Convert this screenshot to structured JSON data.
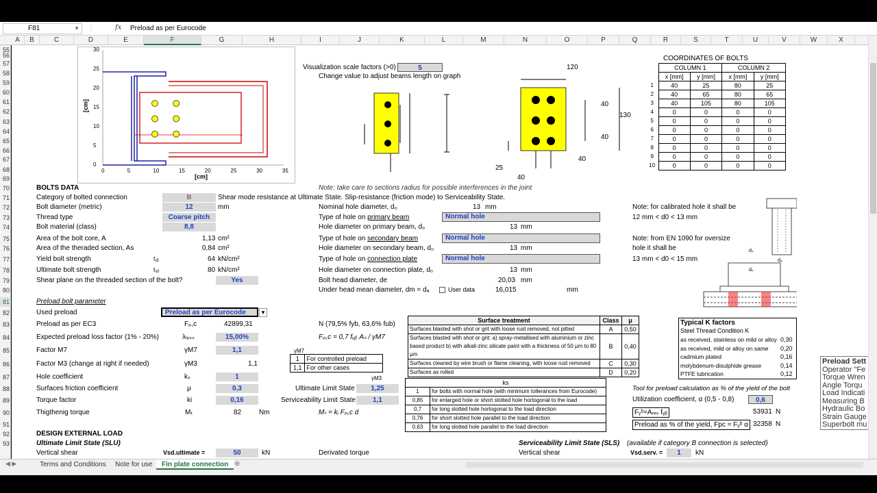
{
  "namebox": "F81",
  "formula": "Preload as per Eurocode",
  "columns": [
    "A",
    "B",
    "C",
    "D",
    "E",
    "F",
    "G",
    "H",
    "I",
    "J",
    "K",
    "L",
    "M",
    "N",
    "O",
    "P",
    "Q",
    "R",
    "S",
    "T",
    "U",
    "V",
    "W",
    "X"
  ],
  "rows": [
    "55",
    "56",
    "57",
    "58",
    "59",
    "60",
    "61",
    "62",
    "63",
    "64",
    "65",
    "66",
    "67",
    "68",
    "69",
    "70",
    "71",
    "72",
    "73",
    "74",
    "75",
    "76",
    "77",
    "78",
    "79",
    "80",
    "81",
    "82",
    "83",
    "84",
    "85",
    "86",
    "87",
    "88",
    "89",
    "90",
    "91",
    "92",
    "93"
  ],
  "selected_row": "81",
  "selected_column": "F",
  "chart": {
    "ylabel": "[cm]",
    "xlabel": "[cm]",
    "yticks": [
      "30",
      "25",
      "20",
      "15",
      "10",
      "5",
      "0"
    ],
    "xticks": [
      "0",
      "5",
      "10",
      "15",
      "20",
      "25",
      "30",
      "35"
    ]
  },
  "viz": {
    "label": "Visualization scale factors (>0)",
    "value": "5",
    "note": "Change value to adjust beams length on graph"
  },
  "diagram": {
    "d120": "120",
    "d40a": "40",
    "d130": "130",
    "d40b": "40",
    "d25": "25",
    "d40c": "40",
    "d40d": "40"
  },
  "coords": {
    "title": "COORDINATES OF BOLTS",
    "col1": "COLUMN 1",
    "col2": "COLUMN 2",
    "sub": [
      "x [mm]",
      "y [mm]",
      "x [mm]",
      "y [mm]"
    ],
    "rows": [
      [
        "1",
        "40",
        "25",
        "80",
        "25"
      ],
      [
        "2",
        "40",
        "65",
        "80",
        "65"
      ],
      [
        "3",
        "40",
        "105",
        "80",
        "105"
      ],
      [
        "4",
        "0",
        "0",
        "0",
        "0"
      ],
      [
        "5",
        "0",
        "0",
        "0",
        "0"
      ],
      [
        "6",
        "0",
        "0",
        "0",
        "0"
      ],
      [
        "7",
        "0",
        "0",
        "0",
        "0"
      ],
      [
        "8",
        "0",
        "0",
        "0",
        "0"
      ],
      [
        "9",
        "0",
        "0",
        "0",
        "0"
      ],
      [
        "10",
        "0",
        "0",
        "0",
        "0"
      ]
    ]
  },
  "bolts": {
    "title": "BOLTS DATA",
    "category_label": "Category of bolted connection",
    "category_value": "B",
    "category_desc": "Shear mode resistance at Ultimate State. Slip-resistance (friction mode) to Serviceability State.",
    "diameter_label": "Bolt diameter (metric)",
    "diameter_value": "12",
    "diameter_unit": "mm",
    "thread_label": "Thread type",
    "thread_value": "Coarse pitch",
    "material_label": "Bolt material (class)",
    "material_value": "8,8",
    "area_core_label": "Area of the bolt core, A",
    "area_core_value": "1,13",
    "area_unit": "cm²",
    "area_thread_label": "Area of the theraded section, As",
    "area_thread_value": "0,84",
    "yield_label": "Yield bolt strength",
    "yield_sym": "fᵧᵦ",
    "yield_value": "64",
    "strength_unit": "kN/cm²",
    "ult_label": "Ultimate bolt strength",
    "ult_sym": "fᵤᵦ",
    "ult_value": "80",
    "shear_label": "Shear plane on the threaded section of the bolt?",
    "shear_value": "Yes",
    "note_sections": "Note: take care to sections radius for possible interferences in the joint"
  },
  "holes": {
    "nominal_label": "Nominal hole diameter, d₀",
    "nominal_value": "13",
    "unit": "mm",
    "type_primary_label": "Type of hole on ",
    "type_primary_link": "primary beam",
    "type_primary_value": "Normal hole",
    "dia_primary_label": "Hole diameter on primary beam, d₀",
    "dia_primary_value": "13",
    "type_secondary_label": "Type of hole on ",
    "type_secondary_link": "secondary beam",
    "type_secondary_value": "Normal hole",
    "dia_secondary_label": "Hole diameter on secondary beam, d₀",
    "dia_secondary_value": "13",
    "type_plate_label": "Type of hole on ",
    "type_plate_link": "connection plate",
    "type_plate_value": "Normal hole",
    "dia_plate_label": "Hole diameter on connection plate, d₀",
    "dia_plate_value": "13",
    "head_label": "Bolt head diameter, de",
    "head_value": "20,03",
    "under_label": "Under head mean diameter, dm = dₐ",
    "user_data": "User data",
    "under_value": "16,015"
  },
  "notes": {
    "cal1": "Note: for calibrated hole it shall be",
    "cal2": "12 mm < d0 < 13 mm",
    "en1": "Note:  from EN 1090 for oversize",
    "en2": "hole it shall be",
    "en3": "13 mm < d0 < 15 mm"
  },
  "preload": {
    "title": "Preload bolt parameter",
    "used_label": "Used preload",
    "used_value": "Preload as per Eurocode",
    "ec3_label": "Preload as per EC3",
    "ec3_sym": "Fₚ,c",
    "ec3_value": "42899,31",
    "ec3_unit": "N  (79,5% fyb, 63,6% fub)",
    "loss_label": "Expected preload loss factor (1% - 20%)",
    "loss_sym": "λₗₒₛₛ",
    "loss_value": "15,00%",
    "fpc_formula": "Fₚ,c = 0,7 fᵤᵦ Aₛ / γM7",
    "m7_label": "Factor M7",
    "m7_sym": "γM7",
    "m7_value": "1,1",
    "m3_label": "Factor M3 (change at right if needed)",
    "m3_sym": "γM3",
    "m3_value": "1,1",
    "gm7_head": "γM7",
    "gm7_rows": [
      [
        "1",
        "For controlled preload"
      ],
      [
        "1,1",
        "For other cases"
      ]
    ],
    "ks_label": "Hole coefficient",
    "ks_sym": "kₛ",
    "ks_value": "1",
    "mu_label": "Surfaces friction coefficient",
    "mu_sym": "μ",
    "mu_value": "0,3",
    "ki_label": "Torque factor",
    "ki_sym": "ki",
    "ki_value": "0,16",
    "tt_label": "Thigthenig torque",
    "tt_sym": "Mₜ",
    "tt_value": "82",
    "tt_unit": "Nm",
    "gm3_head": "γM3",
    "uls_label": "Ultimate Limit State",
    "uls_value": "1,25",
    "sls_label": "Serviceability Limit State",
    "sls_value": "1,1",
    "mt_formula": "Mₜ = kᵢ Fₚ,c d"
  },
  "surface": {
    "head": [
      "Surface treatment",
      "Class",
      "μ"
    ],
    "rows": [
      [
        "Surfaces blasted with shot or grit with loose rust removed, not pitted",
        "A",
        "0,50"
      ],
      [
        "Surfaces blasted with shot or grit: a) spray-metallised with aluminium or zinc based product b) with alkali-zinc silicate paint with a thickness of 50 μm to 80 μm",
        "B",
        "0,40"
      ],
      [
        "Surfaces cleaned by wire brush or flame cleaning, with loose rust removed",
        "C",
        "0,30"
      ],
      [
        "Surfaces as rolled",
        "D",
        "0,20"
      ]
    ]
  },
  "ks": {
    "head": "ks",
    "rows": [
      [
        "1",
        "for bolts with normal hole (with minimum tollerances from Eurocode)"
      ],
      [
        "0,85",
        "for enlarged hole or short slotted hole hortogonal to the load"
      ],
      [
        "0,7",
        "for long slotted hole hortogonal to the load direction"
      ],
      [
        "0,76",
        "for short slotted hole parallel to the load direction"
      ],
      [
        "0,63",
        "for long slotted hole parallel to the load direction"
      ]
    ]
  },
  "kfactors": {
    "title": "Typical K factors",
    "head": "Steel Thread Condition K",
    "rows": [
      [
        "as received, stainless on mild or alloy",
        "0,30"
      ],
      [
        "as received, mild or alloy on same",
        "0,20"
      ],
      [
        "cadmium plated",
        "0,16"
      ],
      [
        "molybdenum-disulphide grease",
        "0,14"
      ],
      [
        "PTFE lubrication",
        "0,12"
      ]
    ]
  },
  "tool": {
    "title": "Tool for preload calculation as % of the yield of the bolt",
    "util_label": "Utilization coefficient, α  (0,5 - 0,8)",
    "util_value": "0,6",
    "fy_label": "Fᵧᵇ=Aᵣₑₛ fᵧᵦ",
    "fy_value": "53931",
    "fy_unit": "N",
    "pre_label": "Preload as % of the yield, Fpc = Fᵧᵇ α",
    "pre_value": "32358",
    "pre_unit": "N"
  },
  "side_list": [
    "Preload Sett",
    "Operator \"Fe",
    "Torque Wren",
    "Angle Torqu",
    "Load Indicati",
    "Measuring B",
    "Hydraulic Bo",
    "Strain Gauge",
    "Superbolt mu"
  ],
  "design": {
    "title": "DESIGN EXTERNAL LOAD",
    "uls": "Ultimate Limit State (SLU)",
    "shear": "Vertical shear",
    "vsd": "Vsd.ultimate =",
    "vsd_value": "50",
    "unit": "kN",
    "derivated": "Derivated torque",
    "sls": "Serviceability Limit State (SLS)",
    "sls_note": "(available if category B connection is selected)",
    "sls_shear": "Vertical shear",
    "vsd_serv": "Vsd.serv. =",
    "vsd_serv_value": "1"
  },
  "diagram_label": {
    "ds": "dₛ",
    "dk": "dₖ",
    "da": "dₐ"
  },
  "tabs": [
    "Terms and Conditions",
    "Note for use",
    "Fin plate connection"
  ]
}
